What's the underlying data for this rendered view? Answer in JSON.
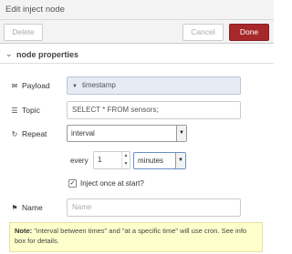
{
  "dialog": {
    "title": "Edit inject node"
  },
  "toolbar": {
    "delete_label": "Delete",
    "cancel_label": "Cancel",
    "done_label": "Done"
  },
  "section": {
    "title": "node properties"
  },
  "payload": {
    "label": "Payload",
    "value": "timestamp"
  },
  "topic": {
    "label": "Topic",
    "value": "SELECT * FROM sensors;"
  },
  "repeat": {
    "label": "Repeat",
    "selected": "interval",
    "every_label": "every",
    "every_value": "1",
    "unit": "minutes"
  },
  "inject_once": {
    "label": "Inject once at start?",
    "checked": true
  },
  "name": {
    "label": "Name",
    "placeholder": "Name"
  },
  "note": {
    "prefix": "Note:",
    "text": " \"interval between times\" and \"at a specific time\" will use cron. See info box for details."
  },
  "colors": {
    "done_button": "#a6282b",
    "payload_bg": "#e6ecf4",
    "note_bg": "#ffffcc"
  }
}
